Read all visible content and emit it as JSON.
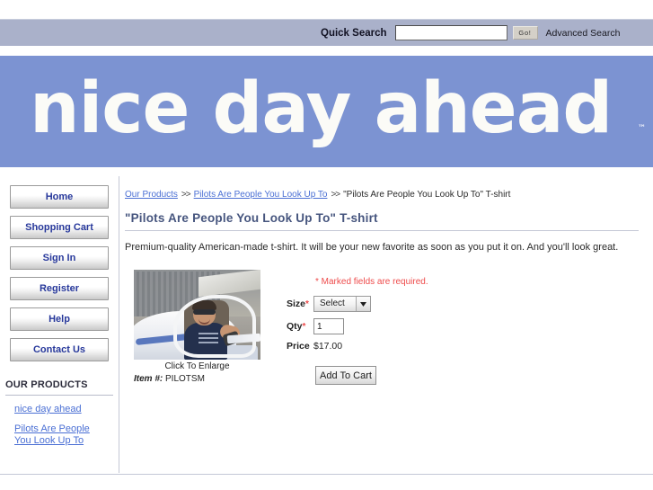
{
  "topbar": {
    "quick_search_label": "Quick Search",
    "search_value": "",
    "search_placeholder": "",
    "go_label": "Go!",
    "advanced_search_label": "Advanced Search"
  },
  "banner": {
    "logo_text": "nice day ahead",
    "tm_mark": "™",
    "background_color": "#7c93d2",
    "logo_color": "#fbfbf7"
  },
  "sidebar": {
    "buttons": [
      {
        "label": "Home"
      },
      {
        "label": "Shopping Cart"
      },
      {
        "label": "Sign In"
      },
      {
        "label": "Register"
      },
      {
        "label": "Help"
      },
      {
        "label": "Contact Us"
      }
    ],
    "products_heading": "OUR PRODUCTS",
    "product_links": [
      {
        "label": "nice day ahead"
      },
      {
        "label": "Pilots Are People You Look Up To"
      }
    ],
    "link_color": "#4a6fd4",
    "button_text_color": "#27389b"
  },
  "breadcrumb": {
    "item1": "Our Products",
    "sep1": ">>",
    "item2": "Pilots Are People You Look Up To",
    "sep2": ">>",
    "current": "\"Pilots Are People You Look Up To\" T-shirt"
  },
  "product": {
    "title": "\"Pilots Are People You Look Up To\" T-shirt",
    "description": "Premium-quality American-made t-shirt. It will be your new favorite as soon as you put it on. And you'll look great.",
    "photo_caption": "Click To Enlarge",
    "item_label": "Item #:",
    "item_number": "PILOTSM"
  },
  "form": {
    "required_note": "* Marked fields are required.",
    "size_label": "Size",
    "size_required_mark": "*",
    "size_value": "Select",
    "qty_label": "Qty",
    "qty_required_mark": "*",
    "qty_value": "1",
    "price_label": "Price",
    "price_value": "$17.00",
    "add_to_cart_label": "Add To Cart",
    "required_color": "#ee4b4b"
  }
}
